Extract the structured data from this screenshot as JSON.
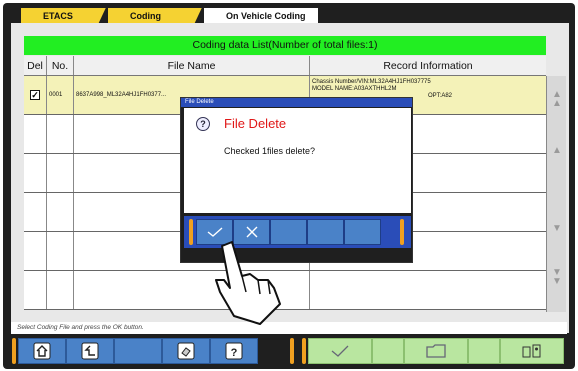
{
  "tabs": [
    "ETACS",
    "Coding",
    "On Vehicle Coding"
  ],
  "table": {
    "title": "Coding data List(Number of total files:1)",
    "columns": [
      "Del",
      "No.",
      "File Name",
      "Record Information"
    ],
    "rows": [
      {
        "checked": "✓",
        "no": "0001",
        "file_name": "8637A998_ML32A4HJ1FH0377...",
        "record_info": [
          "Chassis Number/VIN:ML32A4HJ1FH037775",
          "MODEL NAME:A03AXTHHL2M",
          "OPT:A82"
        ]
      }
    ]
  },
  "dialog": {
    "title": "File Delete",
    "heading": "File Delete",
    "message": "Checked 1files delete?",
    "icon": "question-icon"
  },
  "status": "Select Coding File and press the OK button.",
  "toolbar": {
    "icons": [
      "home-icon",
      "back-icon",
      "print-icon",
      "help-icon",
      "ok-check-icon",
      "folder-icon",
      "storage-icon"
    ]
  },
  "colors": {
    "title_bar": "#22ee22",
    "tab_active": "#f5d232",
    "toolbar_blue": "#4a82c8",
    "dialog_header": "#e01818"
  }
}
